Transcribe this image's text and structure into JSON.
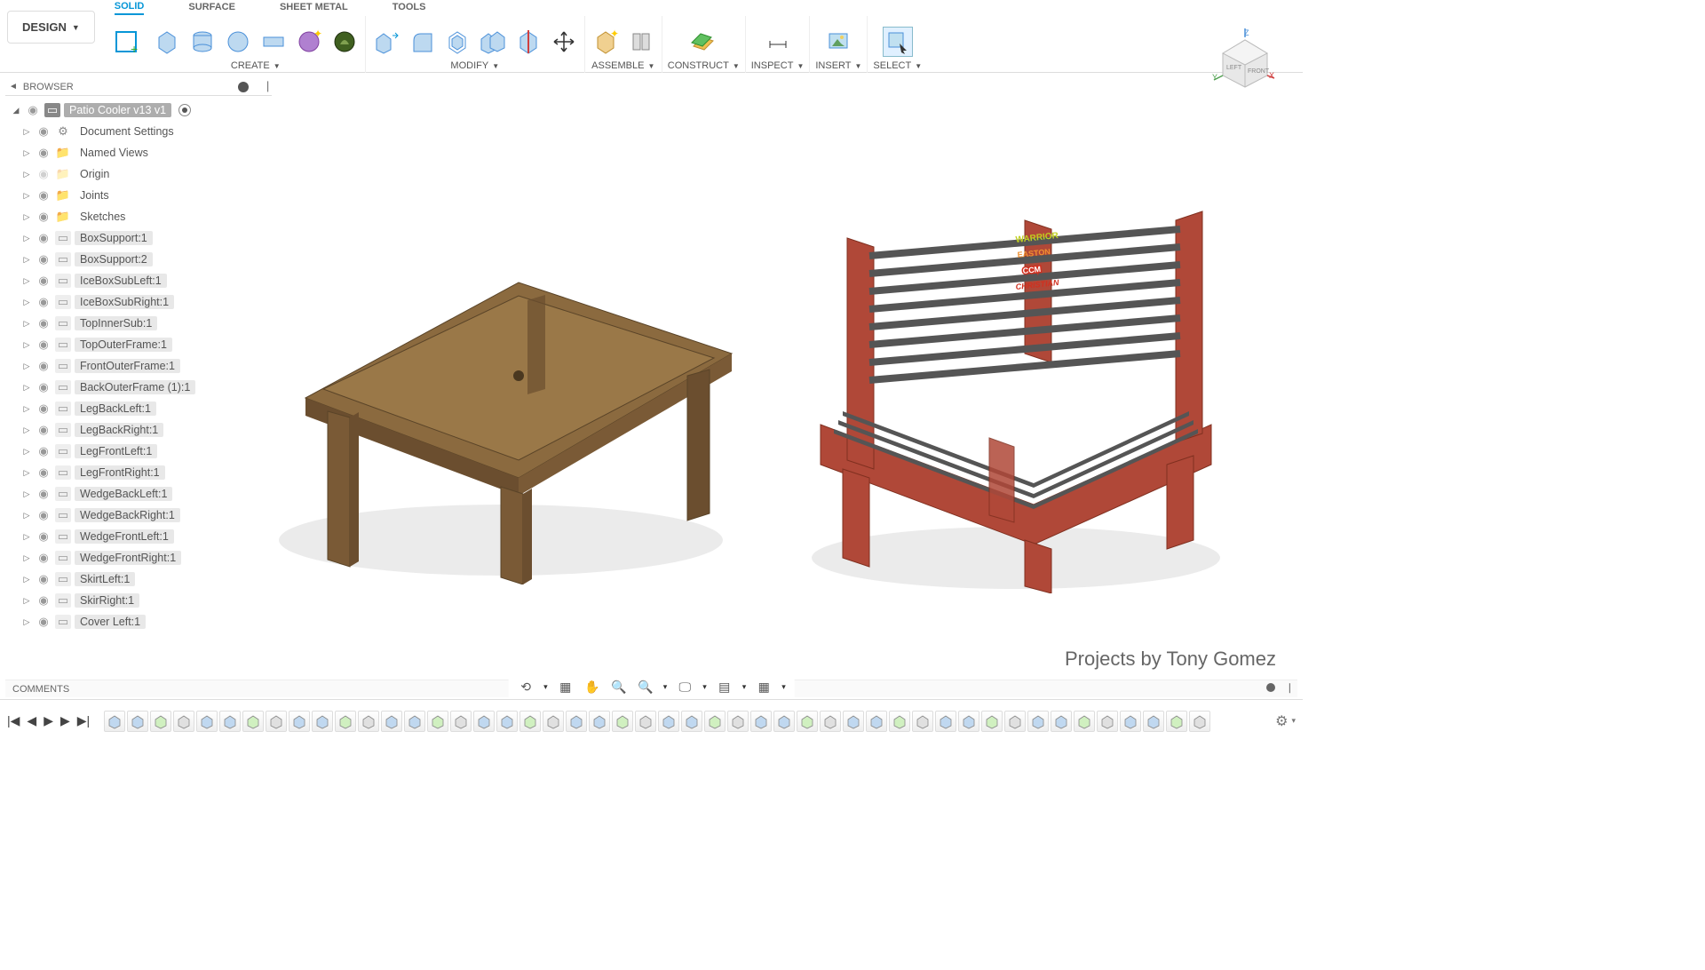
{
  "header": {
    "design_btn": "DESIGN",
    "tabs": [
      "SOLID",
      "SURFACE",
      "SHEET METAL",
      "TOOLS"
    ],
    "active_tab": 0,
    "groups": [
      "CREATE",
      "MODIFY",
      "ASSEMBLE",
      "CONSTRUCT",
      "INSPECT",
      "INSERT",
      "SELECT"
    ]
  },
  "browser": {
    "title": "BROWSER",
    "root": "Patio Cooler v13 v1",
    "items": [
      {
        "icon": "gear",
        "label": "Document Settings"
      },
      {
        "icon": "folder",
        "label": "Named Views"
      },
      {
        "icon": "folder-dim",
        "label": "Origin"
      },
      {
        "icon": "folder",
        "label": "Joints"
      },
      {
        "icon": "folder",
        "label": "Sketches"
      },
      {
        "icon": "comp",
        "label": "BoxSupport:1",
        "hi": true
      },
      {
        "icon": "comp",
        "label": "BoxSupport:2",
        "hi": true
      },
      {
        "icon": "comp",
        "label": "IceBoxSubLeft:1",
        "hi": true
      },
      {
        "icon": "comp",
        "label": "IceBoxSubRight:1",
        "hi": true
      },
      {
        "icon": "comp",
        "label": "TopInnerSub:1",
        "hi": true
      },
      {
        "icon": "comp",
        "label": "TopOuterFrame:1",
        "hi": true
      },
      {
        "icon": "comp",
        "label": "FrontOuterFrame:1",
        "hi": true
      },
      {
        "icon": "comp",
        "label": "BackOuterFrame (1):1",
        "hi": true
      },
      {
        "icon": "comp",
        "label": "LegBackLeft:1",
        "hi": true
      },
      {
        "icon": "comp",
        "label": "LegBackRight:1",
        "hi": true
      },
      {
        "icon": "comp",
        "label": "LegFrontLeft:1",
        "hi": true
      },
      {
        "icon": "comp",
        "label": "LegFrontRight:1",
        "hi": true
      },
      {
        "icon": "comp",
        "label": "WedgeBackLeft:1",
        "hi": true
      },
      {
        "icon": "comp",
        "label": "WedgeBackRight:1",
        "hi": true
      },
      {
        "icon": "comp",
        "label": "WedgeFrontLeft:1",
        "hi": true
      },
      {
        "icon": "comp",
        "label": "WedgeFrontRight:1",
        "hi": true
      },
      {
        "icon": "comp",
        "label": "SkirtLeft:1",
        "hi": true
      },
      {
        "icon": "comp",
        "label": "SkirRight:1",
        "hi": true
      },
      {
        "icon": "comp",
        "label": "Cover Left:1",
        "hi": true
      }
    ]
  },
  "viewcube": {
    "left": "LEFT",
    "front": "FRONT",
    "z": "Z",
    "y": "Y",
    "x": "X"
  },
  "attribution": "Projects by Tony Gomez",
  "comments": {
    "title": "COMMENTS"
  },
  "bench_decals": [
    "WARRIOR",
    "EASTON",
    "CCM",
    "CHRISTIAN"
  ],
  "timeline": {
    "step_count": 48
  }
}
